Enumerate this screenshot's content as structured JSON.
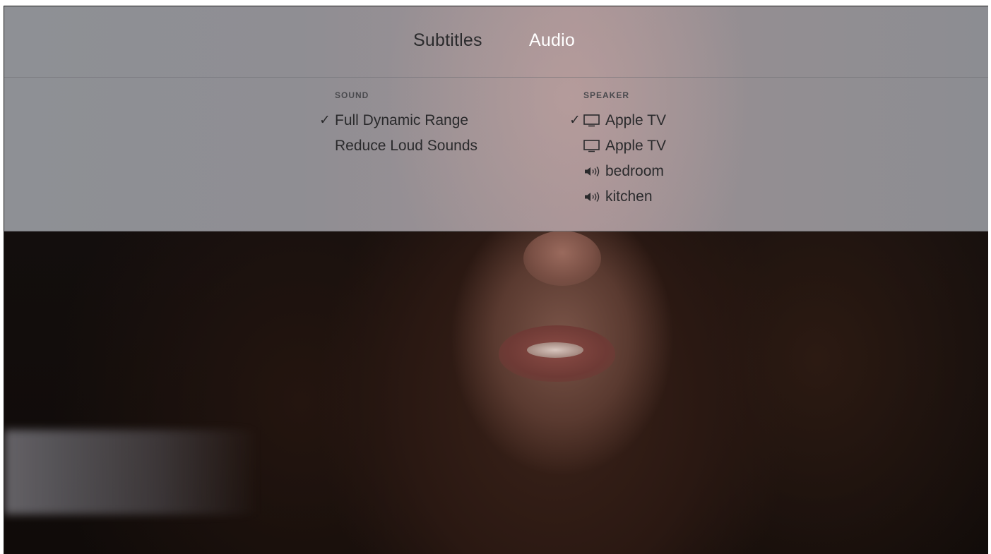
{
  "tabs": [
    {
      "label": "Subtitles",
      "active": false
    },
    {
      "label": "Audio",
      "active": true
    }
  ],
  "sound": {
    "header": "SOUND",
    "options": [
      {
        "label": "Full Dynamic Range",
        "checked": true,
        "check": "✓"
      },
      {
        "label": "Reduce Loud Sounds",
        "checked": false
      }
    ]
  },
  "speaker": {
    "header": "SPEAKER",
    "options": [
      {
        "label": "Apple TV",
        "checked": true,
        "check": "✓",
        "icon": "tv-icon"
      },
      {
        "label": "Apple TV",
        "checked": false,
        "icon": "tv-icon"
      },
      {
        "label": "bedroom",
        "checked": false,
        "icon": "speaker-icon"
      },
      {
        "label": "kitchen",
        "checked": false,
        "icon": "speaker-icon"
      }
    ]
  },
  "colors": {
    "active_tab": "#ffffff",
    "inactive_tab": "#2b2b2d",
    "overlay_tint": "#8f8e93"
  }
}
